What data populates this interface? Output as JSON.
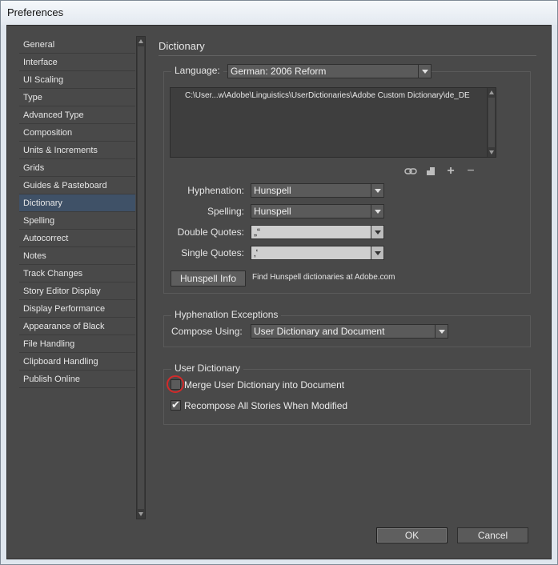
{
  "window": {
    "title": "Preferences"
  },
  "sidebar": {
    "items": [
      {
        "label": "General"
      },
      {
        "label": "Interface"
      },
      {
        "label": "UI Scaling"
      },
      {
        "label": "Type"
      },
      {
        "label": "Advanced Type"
      },
      {
        "label": "Composition"
      },
      {
        "label": "Units & Increments"
      },
      {
        "label": "Grids"
      },
      {
        "label": "Guides & Pasteboard"
      },
      {
        "label": "Dictionary",
        "selected": true
      },
      {
        "label": "Spelling"
      },
      {
        "label": "Autocorrect"
      },
      {
        "label": "Notes"
      },
      {
        "label": "Track Changes"
      },
      {
        "label": "Story Editor Display"
      },
      {
        "label": "Display Performance"
      },
      {
        "label": "Appearance of Black"
      },
      {
        "label": "File Handling"
      },
      {
        "label": "Clipboard Handling"
      },
      {
        "label": "Publish Online"
      }
    ]
  },
  "panel": {
    "title": "Dictionary",
    "language_label": "Language:",
    "language_value": "German: 2006 Reform",
    "dictionary_path": "C:\\User...w\\Adobe\\Linguistics\\UserDictionaries\\Adobe Custom Dictionary\\de_DE",
    "hyphenation_label": "Hyphenation:",
    "hyphenation_value": "Hunspell",
    "spelling_label": "Spelling:",
    "spelling_value": "Hunspell",
    "double_quotes_label": "Double Quotes:",
    "double_quotes_value": "„“",
    "single_quotes_label": "Single Quotes:",
    "single_quotes_value": "‚‘",
    "hunspell_button": "Hunspell Info",
    "hunspell_note": "Find Hunspell dictionaries at Adobe.com"
  },
  "hyphenation_exceptions": {
    "legend": "Hyphenation Exceptions",
    "compose_label": "Compose Using:",
    "compose_value": "User Dictionary and Document"
  },
  "user_dictionary": {
    "legend": "User Dictionary",
    "merge_label": "Merge User Dictionary into Document",
    "merge_checked": false,
    "recompose_label": "Recompose All Stories When Modified",
    "recompose_checked": true
  },
  "buttons": {
    "ok": "OK",
    "cancel": "Cancel"
  },
  "icons": [
    "link-icon",
    "new-page-icon",
    "plus-icon",
    "minus-icon"
  ],
  "colors": {
    "highlight": "#d22a2a",
    "selected_item": "#3f5167"
  }
}
